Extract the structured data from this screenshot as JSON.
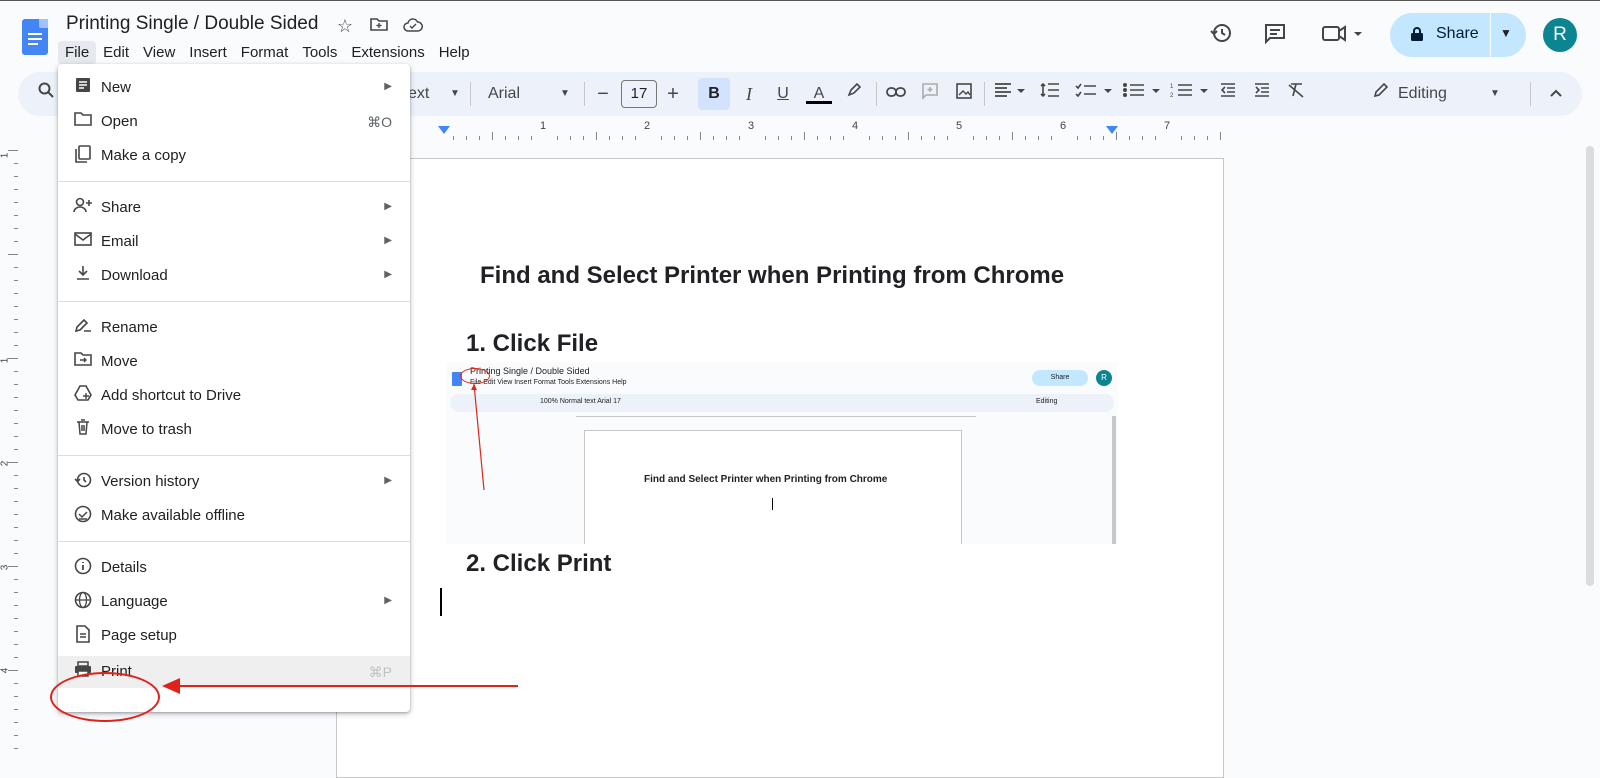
{
  "header": {
    "title": "Printing Single / Double Sided",
    "menu": [
      "File",
      "Edit",
      "View",
      "Insert",
      "Format",
      "Tools",
      "Extensions",
      "Help"
    ],
    "share_label": "Share",
    "avatar_letter": "R"
  },
  "toolbar": {
    "style_partial": "ext",
    "font": "Arial",
    "font_size": "17",
    "mode_label": "Editing"
  },
  "ruler": {
    "numbers": [
      "1",
      "2",
      "3",
      "4",
      "5",
      "6",
      "7"
    ],
    "vnumbers": [
      "1",
      "1",
      "2",
      "3",
      "4"
    ]
  },
  "file_menu": {
    "items": [
      {
        "label": "New",
        "icon": "new-doc-icon",
        "arrow": true
      },
      {
        "label": "Open",
        "icon": "folder-icon",
        "shortcut": "⌘O"
      },
      {
        "label": "Make a copy",
        "icon": "copy-icon"
      },
      {
        "label": "Share",
        "icon": "person-add-icon",
        "arrow": true
      },
      {
        "label": "Email",
        "icon": "mail-icon",
        "arrow": true
      },
      {
        "label": "Download",
        "icon": "download-icon",
        "arrow": true
      },
      {
        "label": "Rename",
        "icon": "rename-icon"
      },
      {
        "label": "Move",
        "icon": "move-folder-icon"
      },
      {
        "label": "Add shortcut to Drive",
        "icon": "drive-shortcut-icon"
      },
      {
        "label": "Move to trash",
        "icon": "trash-icon"
      },
      {
        "label": "Version history",
        "icon": "history-icon",
        "arrow": true
      },
      {
        "label": "Make available offline",
        "icon": "offline-icon"
      },
      {
        "label": "Details",
        "icon": "info-icon"
      },
      {
        "label": "Language",
        "icon": "globe-icon",
        "arrow": true
      },
      {
        "label": "Page setup",
        "icon": "page-setup-icon"
      },
      {
        "label": "Print",
        "icon": "printer-icon",
        "shortcut": "⌘P"
      }
    ]
  },
  "document": {
    "heading": "Find and Select Printer when Printing from Chrome",
    "step1": "1. Click File",
    "step2": "2. Click Print"
  },
  "embedded_screenshot": {
    "title": "Printing Single / Double Sided",
    "menu": "File   Edit   View   Insert   Format   Tools   Extensions   Help",
    "toolbar_text": "100%   Normal text   Arial   17",
    "mode": "Editing",
    "share": "Share",
    "avatar": "R",
    "heading": "Find and Select Printer when Printing from Chrome"
  },
  "colors": {
    "accent": "#c2e7ff",
    "annotation": "#e0231a",
    "avatar": "#0b8592",
    "docs_blue": "#4285f4"
  }
}
